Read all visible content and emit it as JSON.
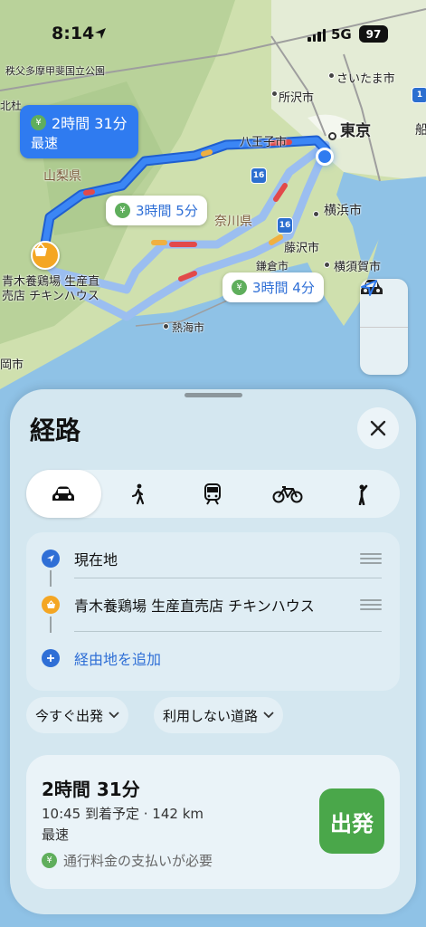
{
  "status_bar": {
    "time": "8:14",
    "network": "5G",
    "battery": "97"
  },
  "map": {
    "labels": {
      "chichibu": "秩父多摩甲斐国立公園",
      "kita": "北杜",
      "saitama": "さいたま市",
      "tokorozawa": "所沢市",
      "tokyo": "東京",
      "funabashi": "船",
      "hachioji": "八王子市",
      "yamanashi": "山梨県",
      "kanagawa": "奈川県",
      "yokohama": "横浜市",
      "fujisawa": "藤沢市",
      "kamakura": "鎌倉市",
      "yokosuka": "横須賀市",
      "atami": "熱海市",
      "shizuoka": "岡市"
    },
    "highway_shields": [
      "16",
      "16",
      "1"
    ],
    "routes": [
      {
        "id": "primary",
        "time": "2時間 31分",
        "tag": "最速"
      },
      {
        "id": "alt1",
        "time": "3時間 5分"
      },
      {
        "id": "alt2",
        "time": "3時間 4分"
      }
    ],
    "destination_label": [
      "青木養鶏場 生産直",
      "売店 チキンハウス"
    ],
    "toll_icon": "¥"
  },
  "sheet": {
    "title": "経路",
    "modes": [
      {
        "name": "drive",
        "selected": true
      },
      {
        "name": "walk",
        "selected": false
      },
      {
        "name": "transit",
        "selected": false
      },
      {
        "name": "cycle",
        "selected": false
      },
      {
        "name": "rideshare",
        "selected": false
      }
    ],
    "stops": {
      "origin": "現在地",
      "destination": "青木養鶏場 生産直売店 チキンハウス",
      "add_stop": "経由地を追加"
    },
    "options": {
      "depart": "今すぐ出発",
      "avoid": "利用しない道路"
    },
    "route_card": {
      "duration": "2時間 31分",
      "eta": "10:45 到着予定 · 142 km",
      "tag": "最速",
      "toll": "通行料金の支払いが必要",
      "go": "出発"
    }
  },
  "colors": {
    "accent": "#2f7bf0",
    "go": "#4aa74a",
    "destination": "#f4a623"
  }
}
